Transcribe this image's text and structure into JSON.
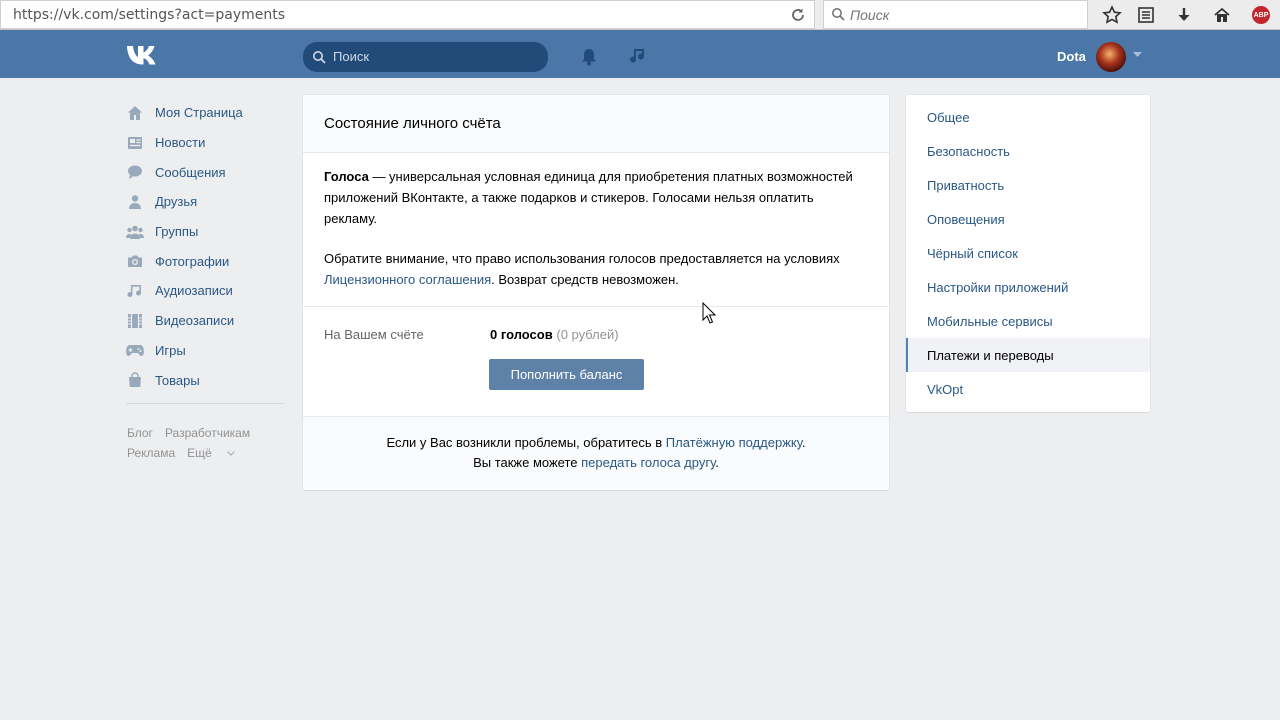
{
  "browser": {
    "url": "https://vk.com/settings?act=payments",
    "search_placeholder": "Поиск",
    "abp_label": "ABP"
  },
  "header": {
    "search_placeholder": "Поиск",
    "user_name": "Dota",
    "brand_color": "#4a76a8"
  },
  "left_nav": {
    "items": [
      {
        "label": "Моя Страница",
        "icon": "home-icon"
      },
      {
        "label": "Новости",
        "icon": "news-icon"
      },
      {
        "label": "Сообщения",
        "icon": "messages-icon"
      },
      {
        "label": "Друзья",
        "icon": "friends-icon"
      },
      {
        "label": "Группы",
        "icon": "groups-icon"
      },
      {
        "label": "Фотографии",
        "icon": "camera-icon"
      },
      {
        "label": "Аудиозаписи",
        "icon": "music-note-icon"
      },
      {
        "label": "Видеозаписи",
        "icon": "film-icon"
      },
      {
        "label": "Игры",
        "icon": "gamepad-icon"
      },
      {
        "label": "Товары",
        "icon": "shopping-bag-icon"
      }
    ],
    "footer": {
      "blog": "Блог",
      "developers": "Разработчикам",
      "ads": "Реклама",
      "more": "Ещё"
    }
  },
  "main": {
    "title": "Состояние личного счёта",
    "intro_bold": "Голоса",
    "intro_rest": " — универсальная условная единица для приобретения платных возможностей приложений ВКонтакте, а также подарков и стикеров. Голосами нельзя оплатить рекламу.",
    "notice_before": "Обратите внимание, что право использования голосов предоставляется на условиях ",
    "notice_link": "Лицензионного соглашения",
    "notice_after": ". Возврат средств невозможен.",
    "balance_label": "На Вашем счёте",
    "balance_votes": "0 голосов",
    "balance_rub": "(0 рублей)",
    "topup_button": "Пополнить баланс",
    "footer_line1_before": "Если у Вас возникли проблемы, обратитесь в ",
    "footer_line1_link": "Платёжную поддержку",
    "footer_line1_after": ".",
    "footer_line2_before": "Вы также можете ",
    "footer_line2_link": "передать голоса другу",
    "footer_line2_after": "."
  },
  "right_menu": {
    "items": [
      {
        "label": "Общее"
      },
      {
        "label": "Безопасность"
      },
      {
        "label": "Приватность"
      },
      {
        "label": "Оповещения"
      },
      {
        "label": "Чёрный список"
      },
      {
        "label": "Настройки приложений"
      },
      {
        "label": "Мобильные сервисы"
      },
      {
        "label": "Платежи и переводы",
        "active": true
      },
      {
        "label": "VkOpt"
      }
    ]
  }
}
